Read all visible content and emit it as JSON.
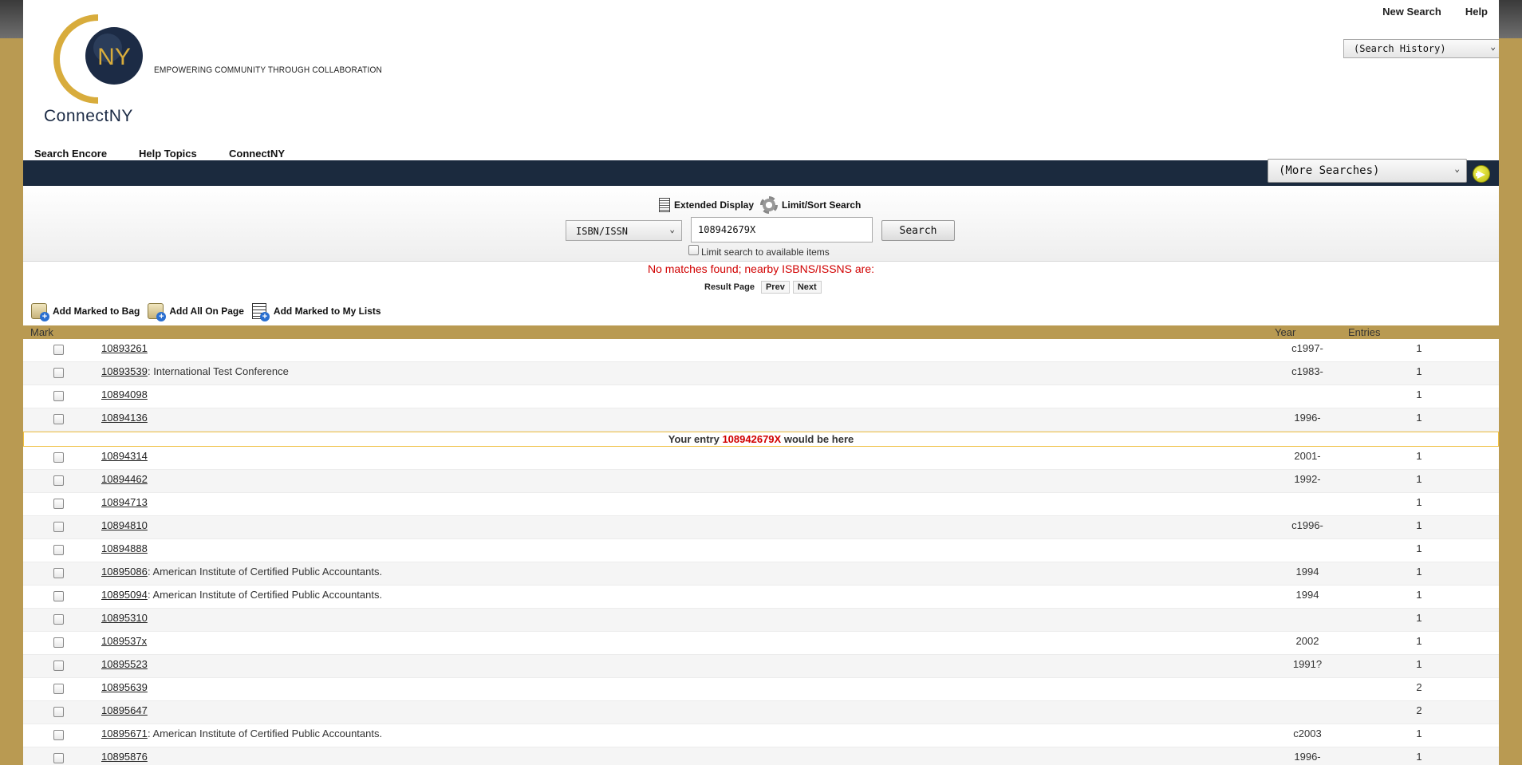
{
  "header": {
    "logo_text": "ConnectNY",
    "logo_badge": "NY",
    "tagline": "EMPOWERING COMMUNITY THROUGH COLLABORATION",
    "top_links": [
      "New Search",
      "Help"
    ],
    "search_history": "(Search History)"
  },
  "nav": {
    "items": [
      "Search Encore",
      "Help Topics",
      "ConnectNY"
    ],
    "more_searches": "(More Searches)"
  },
  "search": {
    "extended_display": "Extended Display",
    "limit_sort": "Limit/Sort Search",
    "type": "ISBN/ISSN",
    "query": "108942679X",
    "button": "Search",
    "limit_available": "Limit search to available items"
  },
  "results": {
    "no_match": "No matches found; nearby ISBNS/ISSNS are:",
    "result_page_label": "Result Page",
    "prev": "Prev",
    "next": "Next",
    "actions": [
      "Add Marked to Bag",
      "Add All On Page",
      "Add Marked to My Lists"
    ],
    "columns": {
      "mark": "Mark",
      "year": "Year",
      "entries": "Entries"
    },
    "entry_prefix": "Your entry",
    "entry_value": "108942679X",
    "entry_suffix": "would be here",
    "rows_before": [
      {
        "number": "10893261",
        "title": "",
        "year": "c1997-",
        "entries": "1"
      },
      {
        "number": "10893539",
        "title": " : International Test Conference",
        "year": "c1983-",
        "entries": "1"
      },
      {
        "number": "10894098",
        "title": "",
        "year": "",
        "entries": "1"
      },
      {
        "number": "10894136",
        "title": "",
        "year": "1996-",
        "entries": "1"
      }
    ],
    "rows_after": [
      {
        "number": "10894314",
        "title": "",
        "year": "2001-",
        "entries": "1"
      },
      {
        "number": "10894462",
        "title": "",
        "year": "1992-",
        "entries": "1"
      },
      {
        "number": "10894713",
        "title": "",
        "year": "",
        "entries": "1"
      },
      {
        "number": "10894810",
        "title": "",
        "year": "c1996-",
        "entries": "1"
      },
      {
        "number": "10894888",
        "title": "",
        "year": "",
        "entries": "1"
      },
      {
        "number": "10895086",
        "title": " : American Institute of Certified Public Accountants.",
        "year": "1994",
        "entries": "1"
      },
      {
        "number": "10895094",
        "title": " : American Institute of Certified Public Accountants.",
        "year": "1994",
        "entries": "1"
      },
      {
        "number": "10895310",
        "title": "",
        "year": "",
        "entries": "1"
      },
      {
        "number": "1089537x",
        "title": "",
        "year": "2002",
        "entries": "1"
      },
      {
        "number": "10895523",
        "title": "",
        "year": "1991?",
        "entries": "1"
      },
      {
        "number": "10895639",
        "title": "",
        "year": "",
        "entries": "2"
      },
      {
        "number": "10895647",
        "title": "",
        "year": "",
        "entries": "2"
      },
      {
        "number": "10895671",
        "title": " : American Institute of Certified Public Accountants.",
        "year": "c2003",
        "entries": "1"
      },
      {
        "number": "10895876",
        "title": "",
        "year": "1996-",
        "entries": "1"
      }
    ]
  },
  "colors": {
    "frame": "#b99a52",
    "navbar": "#1b2a3e",
    "error": "#d10000",
    "logo_navy": "#1c2b45",
    "logo_gold": "#d8ac3c"
  }
}
